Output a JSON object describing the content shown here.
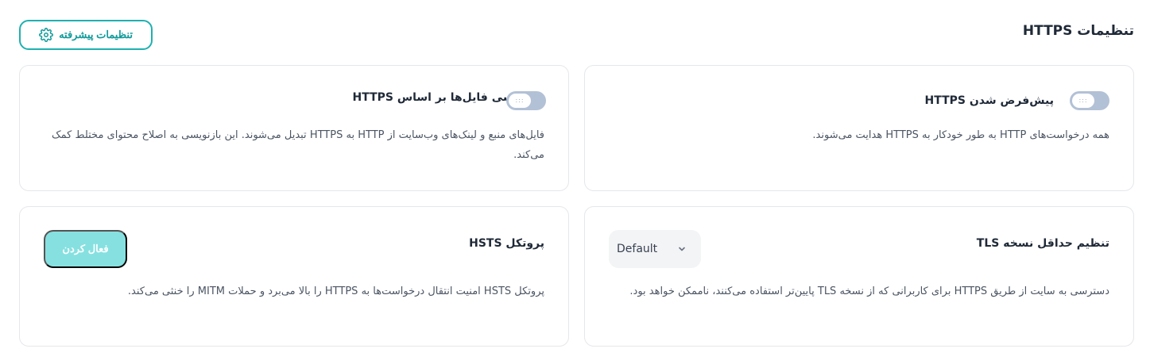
{
  "page": {
    "title": "تنظیمات HTTPS",
    "advanced_button_label": "تنظیمات پیشرفته",
    "advanced_button_icon": "gear-icon",
    "accent_color": "#1fb0b0"
  },
  "cards": {
    "default_https": {
      "title": "پیش‌فرض شدن HTTPS",
      "description": "همه درخواست‌های HTTP به طور خودکار به HTTPS هدایت می‌شوند.",
      "toggle_on": false
    },
    "rewrite_https": {
      "title": "بازنویسی فایل‌ها بر اساس HTTPS",
      "description": "فایل‌های منبع و لینک‌های وب‌سایت از HTTP به HTTPS تبدیل می‌شوند. این بازنویسی به اصلاح محتوای مختلط کمک می‌کند.",
      "toggle_on": false
    },
    "tls_min": {
      "title": "تنظیم حداقل نسخه TLS",
      "description": "دسترسی به سایت از طریق HTTPS برای کاربرانی که از نسخه TLS پایین‌تر استفاده می‌کنند، ناممکن خواهد بود.",
      "select_value": "Default"
    },
    "hsts": {
      "title": "پروتکل HSTS",
      "description": "پروتکل HSTS امنیت انتقال درخواست‌ها به HTTPS را بالا می‌برد و حملات MITM را خنثی می‌کند.",
      "button_label": "فعال کردن"
    }
  }
}
